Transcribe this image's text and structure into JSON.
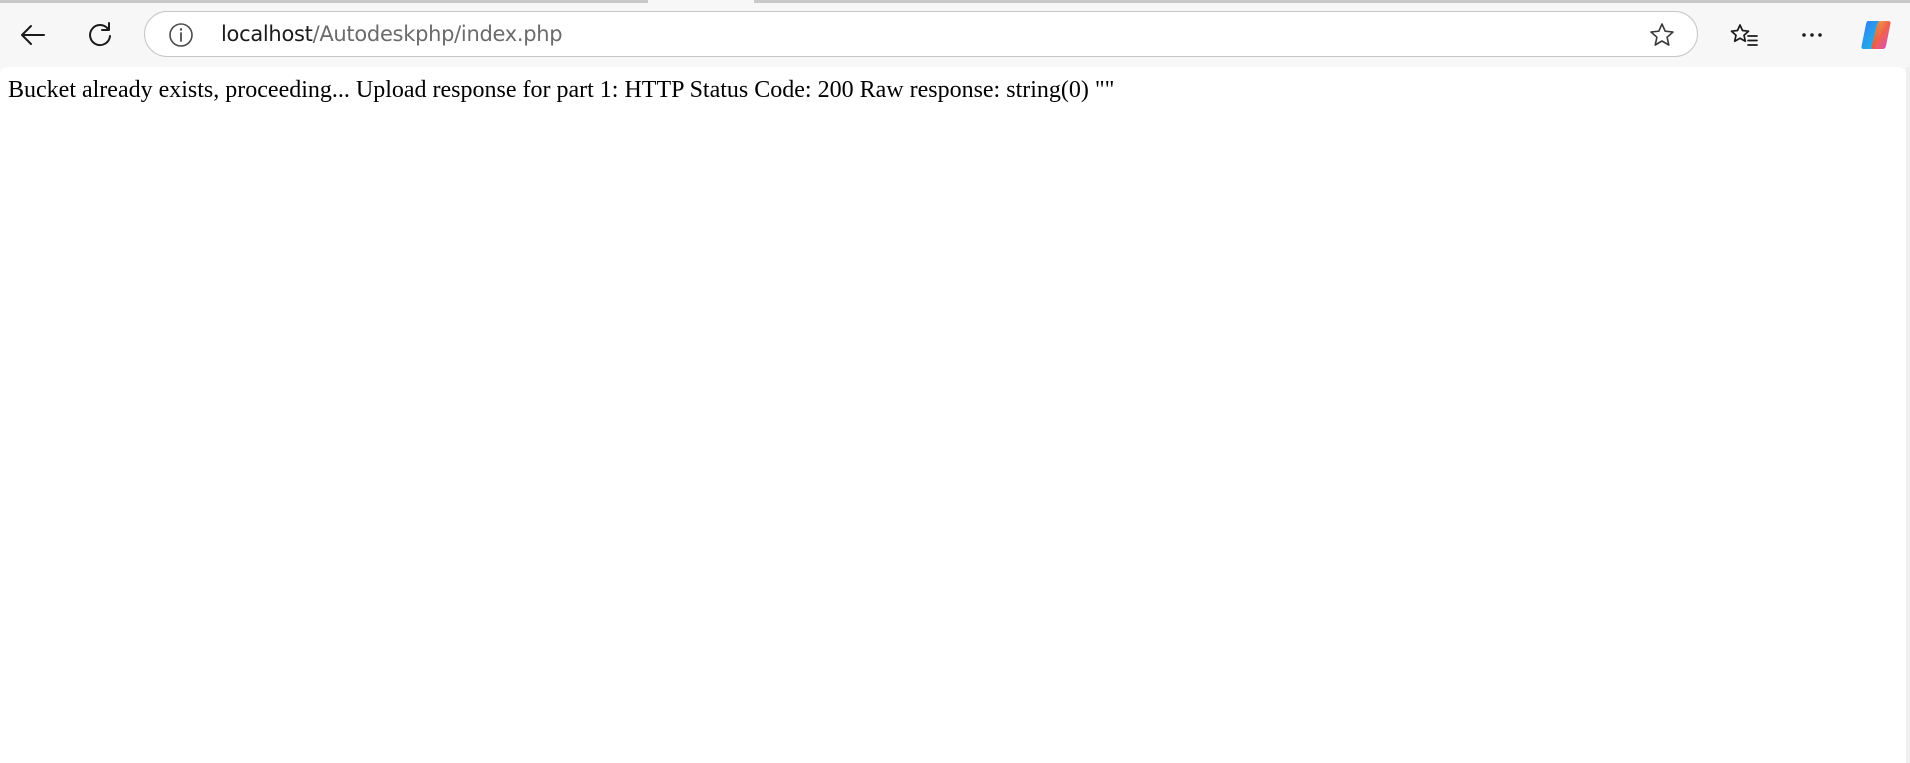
{
  "browser": {
    "address_bar": {
      "host": "localhost",
      "path": "/Autodeskphp/index.php"
    },
    "icons": {
      "back": "back-arrow-icon",
      "reload": "reload-icon",
      "site_info": "info-icon",
      "favorite": "star-outline-icon",
      "favorites_menu": "favorites-list-icon",
      "more": "ellipsis-icon",
      "copilot": "copilot-icon"
    }
  },
  "page": {
    "body_text": "Bucket already exists, proceeding... Upload response for part 1: HTTP Status Code: 200 Raw response: string(0) \"\""
  },
  "colors": {
    "toolbar_bg": "#f7f7f7",
    "page_bg": "#ffffff",
    "text": "#000000"
  }
}
